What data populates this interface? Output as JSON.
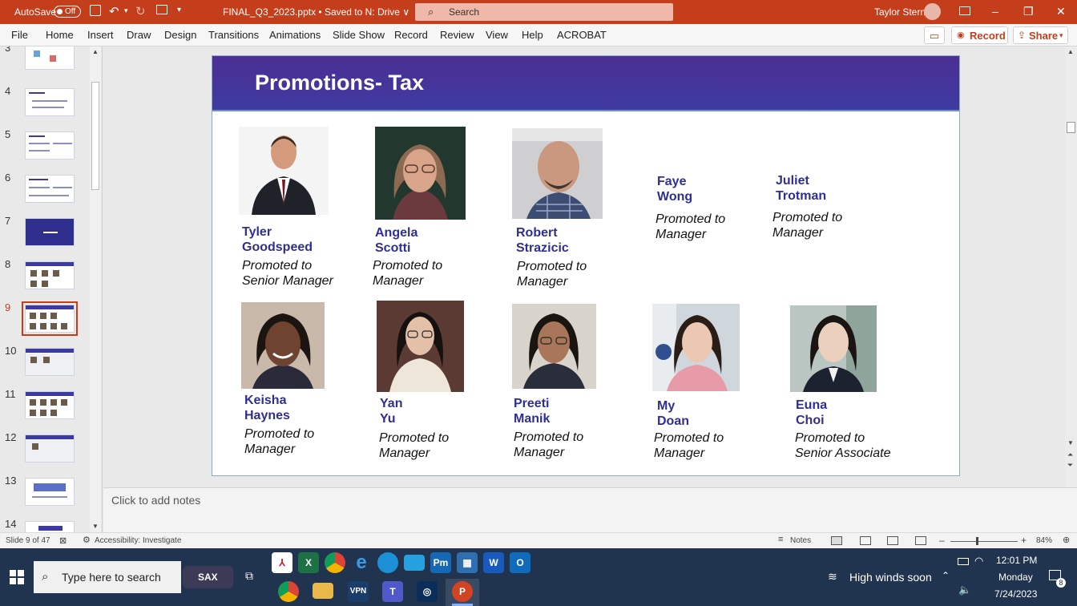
{
  "titlebar": {
    "autosave_label": "AutoSave",
    "autosave_state": "Off",
    "file_title": "FINAL_Q3_2023.pptx • Saved to N: Drive ∨",
    "search_placeholder": "Search",
    "user_name": "Taylor Stern"
  },
  "ribbon": {
    "tabs": [
      "File",
      "Home",
      "Insert",
      "Draw",
      "Design",
      "Transitions",
      "Animations",
      "Slide Show",
      "Record",
      "Review",
      "View",
      "Help",
      "ACROBAT"
    ],
    "record_button": "Record",
    "share_button": "Share"
  },
  "thumbnails": {
    "numbers": [
      "3",
      "4",
      "5",
      "6",
      "7",
      "8",
      "9",
      "10",
      "11",
      "12",
      "13",
      "14"
    ],
    "selected": "9"
  },
  "slide": {
    "title": "Promotions- Tax",
    "people": [
      {
        "first": "Tyler",
        "last": "Goodspeed",
        "promo1": "Promoted to",
        "promo2": "Senior Manager"
      },
      {
        "first": "Angela",
        "last": "Scotti",
        "promo1": "Promoted to",
        "promo2": "Manager"
      },
      {
        "first": "Robert",
        "last": "Strazicic",
        "promo1": "Promoted to",
        "promo2": "Manager"
      },
      {
        "first": "Faye",
        "last": "Wong",
        "promo1": "Promoted to",
        "promo2": "Manager"
      },
      {
        "first": "Juliet",
        "last": "Trotman",
        "promo1": "Promoted to",
        "promo2": "Manager"
      },
      {
        "first": "Keisha",
        "last": "Haynes",
        "promo1": "Promoted to",
        "promo2": "Manager"
      },
      {
        "first": "Yan",
        "last": "Yu",
        "promo1": "Promoted to",
        "promo2": "Manager"
      },
      {
        "first": "Preeti",
        "last": "Manik",
        "promo1": "Promoted to",
        "promo2": "Manager"
      },
      {
        "first": "My",
        "last": "Doan",
        "promo1": "Promoted to",
        "promo2": "Manager"
      },
      {
        "first": "Euna",
        "last": "Choi",
        "promo1": "Promoted to",
        "promo2": "Senior Associate"
      }
    ]
  },
  "notes": {
    "placeholder": "Click to add notes"
  },
  "statusbar": {
    "slide_info": "Slide 9 of 47",
    "accessibility": "Accessibility: Investigate",
    "notes_button": "Notes",
    "zoom": "84%"
  },
  "taskbar": {
    "search_placeholder": "Type here to search",
    "sax_label": "SAX",
    "weather": "High winds soon",
    "time": "12:01 PM",
    "day": "Monday",
    "date": "7/24/2023",
    "notification_count": "8"
  },
  "colors": {
    "titlebar": "#c43e1c",
    "slide_header": "#3f3aa0",
    "name_text": "#2f2f8f",
    "taskbar": "#20334f"
  }
}
